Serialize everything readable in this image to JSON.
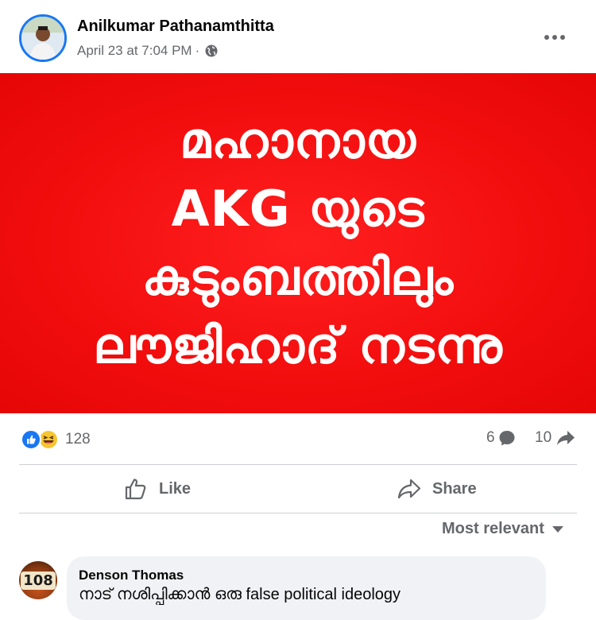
{
  "post": {
    "author": "Anilkumar Pathanamthitta",
    "timestamp": "April 23 at 7:04 PM",
    "separator": "·",
    "privacy_icon": "globe-icon",
    "more_icon": "more-horizontal-icon",
    "image_text_lines": [
      "മഹാനായ",
      "AKG യുടെ",
      "കുടുംബത്തിലും",
      "ലൗജിഹാദ് നടന്നു"
    ],
    "image_background": "#f20d0d"
  },
  "stats": {
    "reaction_icons": [
      "like-reaction-icon",
      "haha-reaction-icon"
    ],
    "reaction_count": "128",
    "comment_count": "6",
    "share_count": "10"
  },
  "actions": {
    "like_label": "Like",
    "share_label": "Share"
  },
  "sort": {
    "label": "Most relevant"
  },
  "comments": [
    {
      "author": "Denson Thomas",
      "avatar_text": "108",
      "text": "നാട് നശിപ്പിക്കാൻ ഒരു false political ideology"
    }
  ],
  "colors": {
    "accent": "#1877f2",
    "secondary_text": "#65676b",
    "bubble": "#f0f2f5"
  }
}
